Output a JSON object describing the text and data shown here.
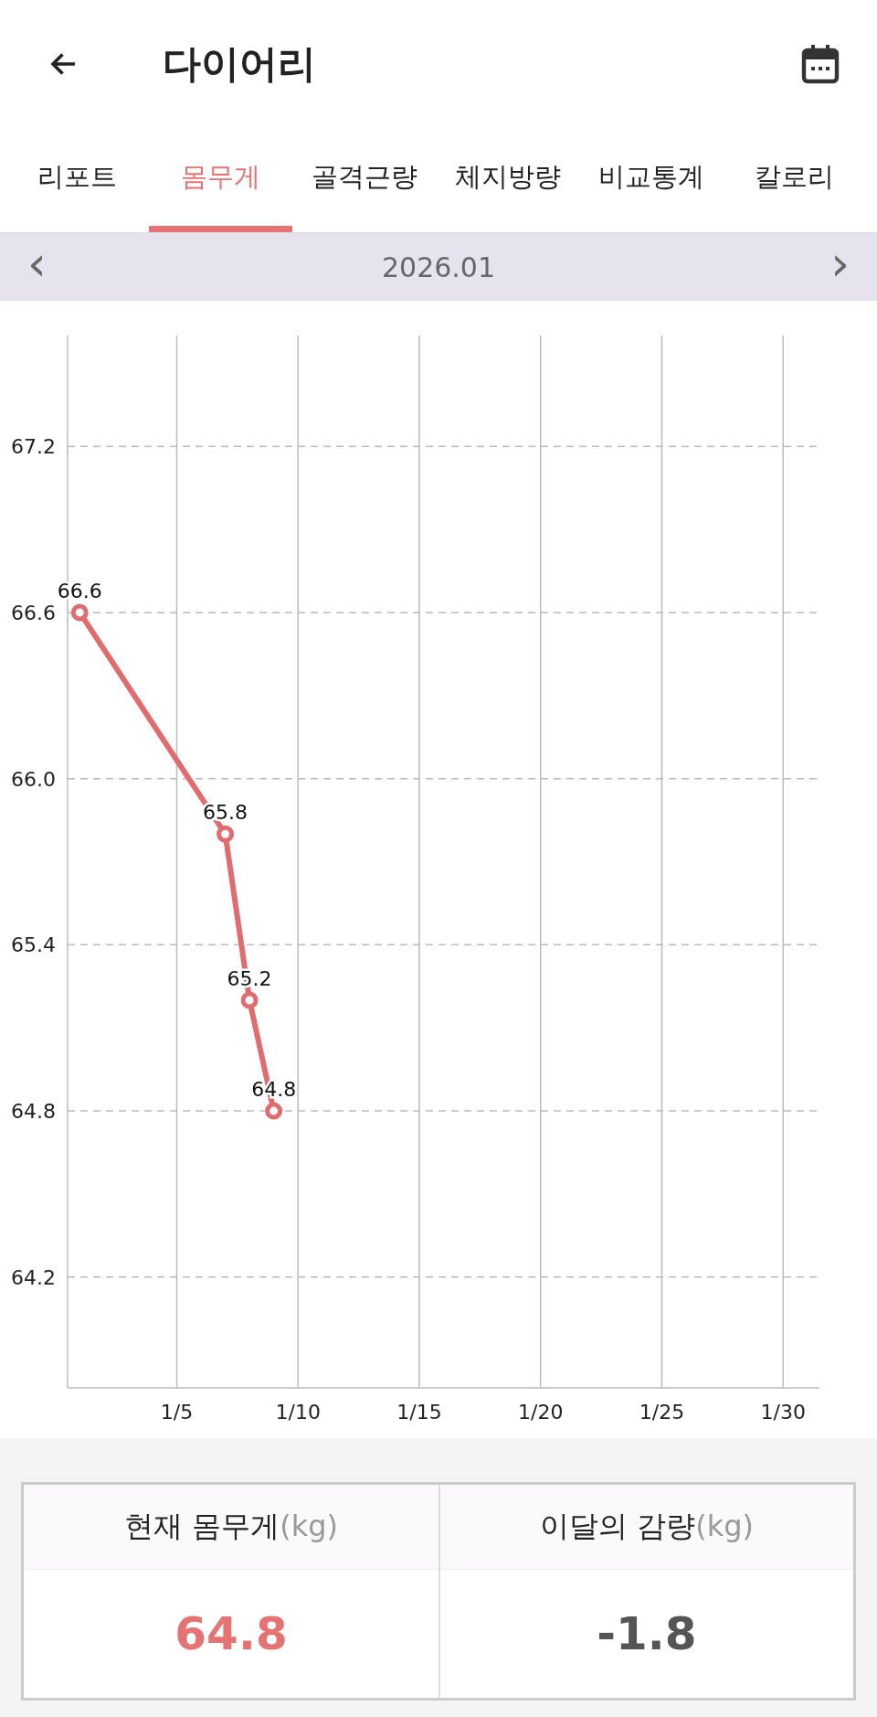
{
  "header": {
    "title": "다이어리"
  },
  "tabs": [
    {
      "label": "리포트",
      "selected": false
    },
    {
      "label": "몸무게",
      "selected": true
    },
    {
      "label": "골격근량",
      "selected": false
    },
    {
      "label": "체지방량",
      "selected": false
    },
    {
      "label": "비교통계",
      "selected": false
    },
    {
      "label": "칼로리",
      "selected": false
    }
  ],
  "month_nav": {
    "prev": "‹",
    "label": "2026.01",
    "next": "›"
  },
  "chart": {
    "chart_data": {
      "type": "line",
      "categories": [
        null,
        null,
        null,
        null,
        "1/5",
        null,
        null,
        null,
        null,
        "1/10",
        null,
        null,
        null,
        null,
        "1/15",
        null,
        null,
        null,
        null,
        "1/20",
        null,
        null,
        null,
        null,
        "1/25",
        null,
        null,
        null,
        null,
        "1/30",
        null
      ],
      "grid": true,
      "series": [
        {
          "color": "#e06c70",
          "marker": "circle",
          "values": [
            66.6,
            null,
            null,
            null,
            null,
            null,
            65.8,
            65.2,
            64.8,
            null,
            null,
            null,
            null,
            null,
            null,
            null,
            null,
            null,
            null,
            null,
            null,
            null,
            null,
            null,
            null,
            null,
            null,
            null,
            null,
            null,
            null
          ]
        }
      ],
      "ylim": [
        63.8,
        67.6
      ],
      "yticks": [
        {
          "value": 64.2,
          "label": "64.2"
        },
        {
          "value": 64.8,
          "label": "64.8"
        },
        {
          "value": 65.4,
          "label": "65.4"
        },
        {
          "value": 66.0,
          "label": "66.0"
        },
        {
          "value": 66.6,
          "label": "66.6"
        },
        {
          "value": 67.2,
          "label": "67.2"
        }
      ],
      "data_labels": true
    }
  },
  "summary": [
    {
      "label": "현재 몸무게",
      "unit": "(kg)",
      "value": "64.8",
      "highlight": true
    },
    {
      "label": "이달의 감량",
      "unit": "(kg)",
      "value": "-1.8",
      "highlight": false
    }
  ]
}
